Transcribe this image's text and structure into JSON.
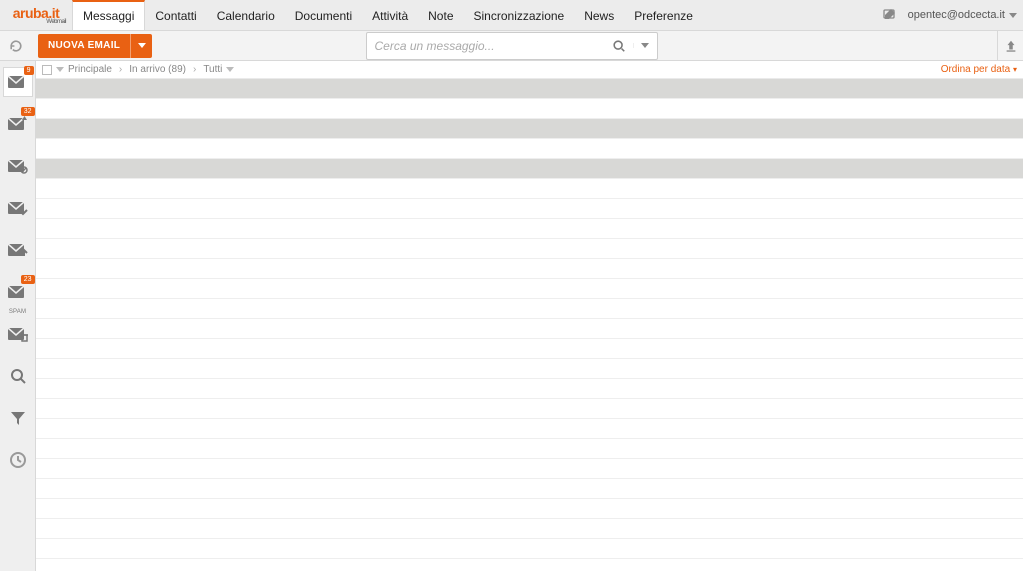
{
  "logo": {
    "brand": "aruba.it",
    "sub": "Webmail"
  },
  "tabs": [
    {
      "label": "Messaggi",
      "active": true
    },
    {
      "label": "Contatti"
    },
    {
      "label": "Calendario"
    },
    {
      "label": "Documenti"
    },
    {
      "label": "Attività"
    },
    {
      "label": "Note"
    },
    {
      "label": "Sincronizzazione"
    },
    {
      "label": "News"
    },
    {
      "label": "Preferenze"
    }
  ],
  "user_email": "opentec@odcecta.it",
  "toolbar": {
    "new_email": "NUOVA EMAIL",
    "search_placeholder": "Cerca un messaggio..."
  },
  "rail": [
    {
      "icon": "inbox",
      "badge": "9",
      "active": true
    },
    {
      "icon": "outbox",
      "badge": "32"
    },
    {
      "icon": "sent"
    },
    {
      "icon": "check"
    },
    {
      "icon": "upload-mail"
    },
    {
      "icon": "spam",
      "badge": "23",
      "sublabel": "SPAM"
    },
    {
      "icon": "trash"
    },
    {
      "icon": "search"
    },
    {
      "icon": "filter"
    },
    {
      "icon": "recent"
    }
  ],
  "breadcrumb": {
    "account": "Principale",
    "folder": "In arrivo",
    "folder_count": "(89)",
    "filter": "Tutti"
  },
  "sort_label": "Ordina per data",
  "message_rows": [
    {
      "highlight": true
    },
    {},
    {
      "highlight": true
    },
    {},
    {
      "highlight": true
    },
    {},
    {},
    {},
    {},
    {},
    {},
    {},
    {},
    {},
    {},
    {},
    {},
    {},
    {},
    {},
    {},
    {},
    {},
    {}
  ]
}
